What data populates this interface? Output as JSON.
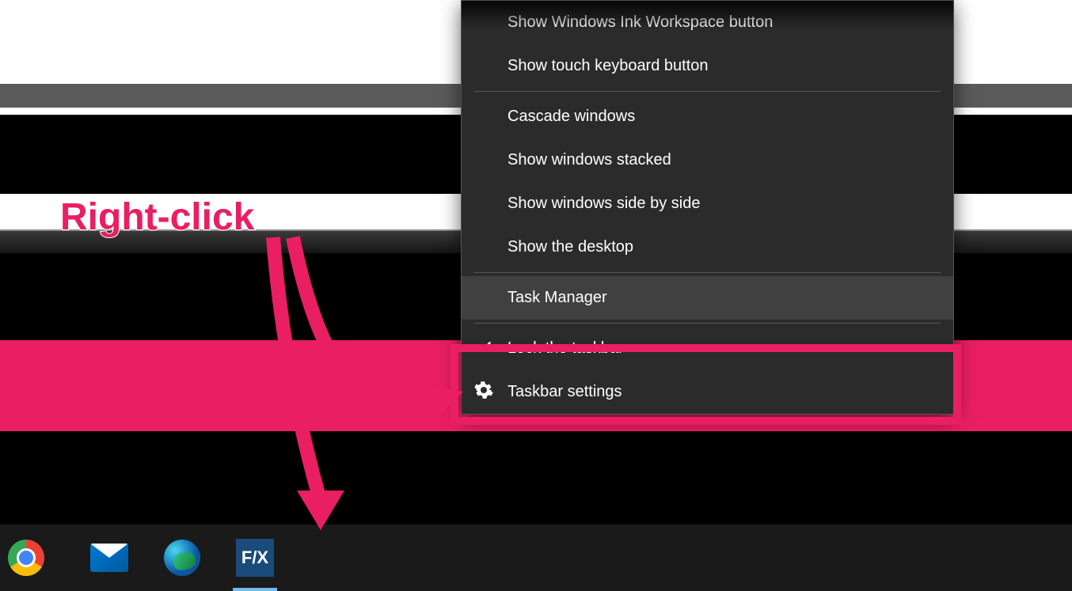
{
  "annotation": {
    "label": "Right-click"
  },
  "context_menu": {
    "items": [
      {
        "label": "Show Windows Ink Workspace button",
        "icon": null,
        "highlighted": false
      },
      {
        "label": "Show touch keyboard button",
        "icon": null,
        "highlighted": false
      }
    ],
    "items2": [
      {
        "label": "Cascade windows",
        "icon": null,
        "highlighted": false
      },
      {
        "label": "Show windows stacked",
        "icon": null,
        "highlighted": false
      },
      {
        "label": "Show windows side by side",
        "icon": null,
        "highlighted": false
      },
      {
        "label": "Show the desktop",
        "icon": null,
        "highlighted": false
      }
    ],
    "items3": [
      {
        "label": "Task Manager",
        "icon": null,
        "highlighted": true
      }
    ],
    "items4": [
      {
        "label": "Lock the taskbar",
        "icon": "check",
        "highlighted": false
      },
      {
        "label": "Taskbar settings",
        "icon": "gear",
        "highlighted": false
      }
    ]
  },
  "taskbar": {
    "apps": [
      {
        "name": "chrome",
        "active": false
      },
      {
        "name": "mail",
        "active": false
      },
      {
        "name": "edge",
        "active": false
      },
      {
        "name": "fx",
        "active": true,
        "label": "F/X"
      }
    ]
  },
  "colors": {
    "accent": "#e91e63",
    "menu_bg": "#2b2b2b",
    "menu_hover": "#404040"
  }
}
